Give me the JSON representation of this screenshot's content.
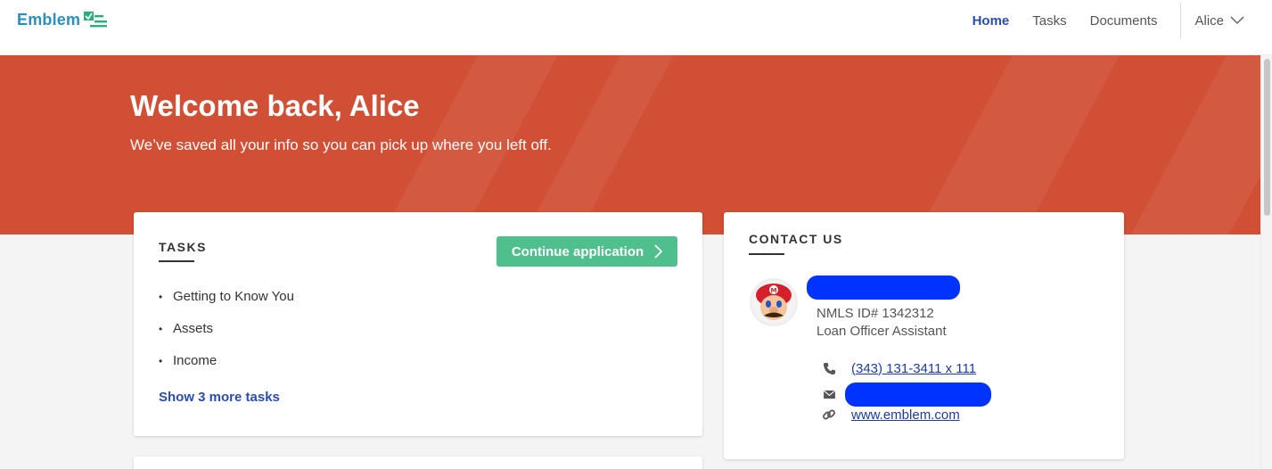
{
  "header": {
    "logo_text": "Emblem",
    "nav": [
      {
        "label": "Home",
        "active": true
      },
      {
        "label": "Tasks",
        "active": false
      },
      {
        "label": "Documents",
        "active": false
      }
    ],
    "user_name": "Alice"
  },
  "hero": {
    "title": "Welcome back, Alice",
    "subtitle": "We’ve saved all your info so you can pick up where you left off.",
    "color": "#d14f35"
  },
  "tasks": {
    "heading": "TASKS",
    "continue_label": "Continue application",
    "items": [
      "Getting to Know You",
      "Assets",
      "Income"
    ],
    "show_more_label": "Show 3 more tasks"
  },
  "contact": {
    "heading": "CONTACT US",
    "nmls": "NMLS ID# 1342312",
    "role": "Loan Officer Assistant",
    "phone": "(343) 131-3411 x 111",
    "website": "www.emblem.com",
    "redaction_color": "#0033ff"
  },
  "colors": {
    "accent_blue": "#2a4db0",
    "button_green": "#4fc08d",
    "logo_blue": "#2a8fc0",
    "logo_green": "#27b07a"
  }
}
